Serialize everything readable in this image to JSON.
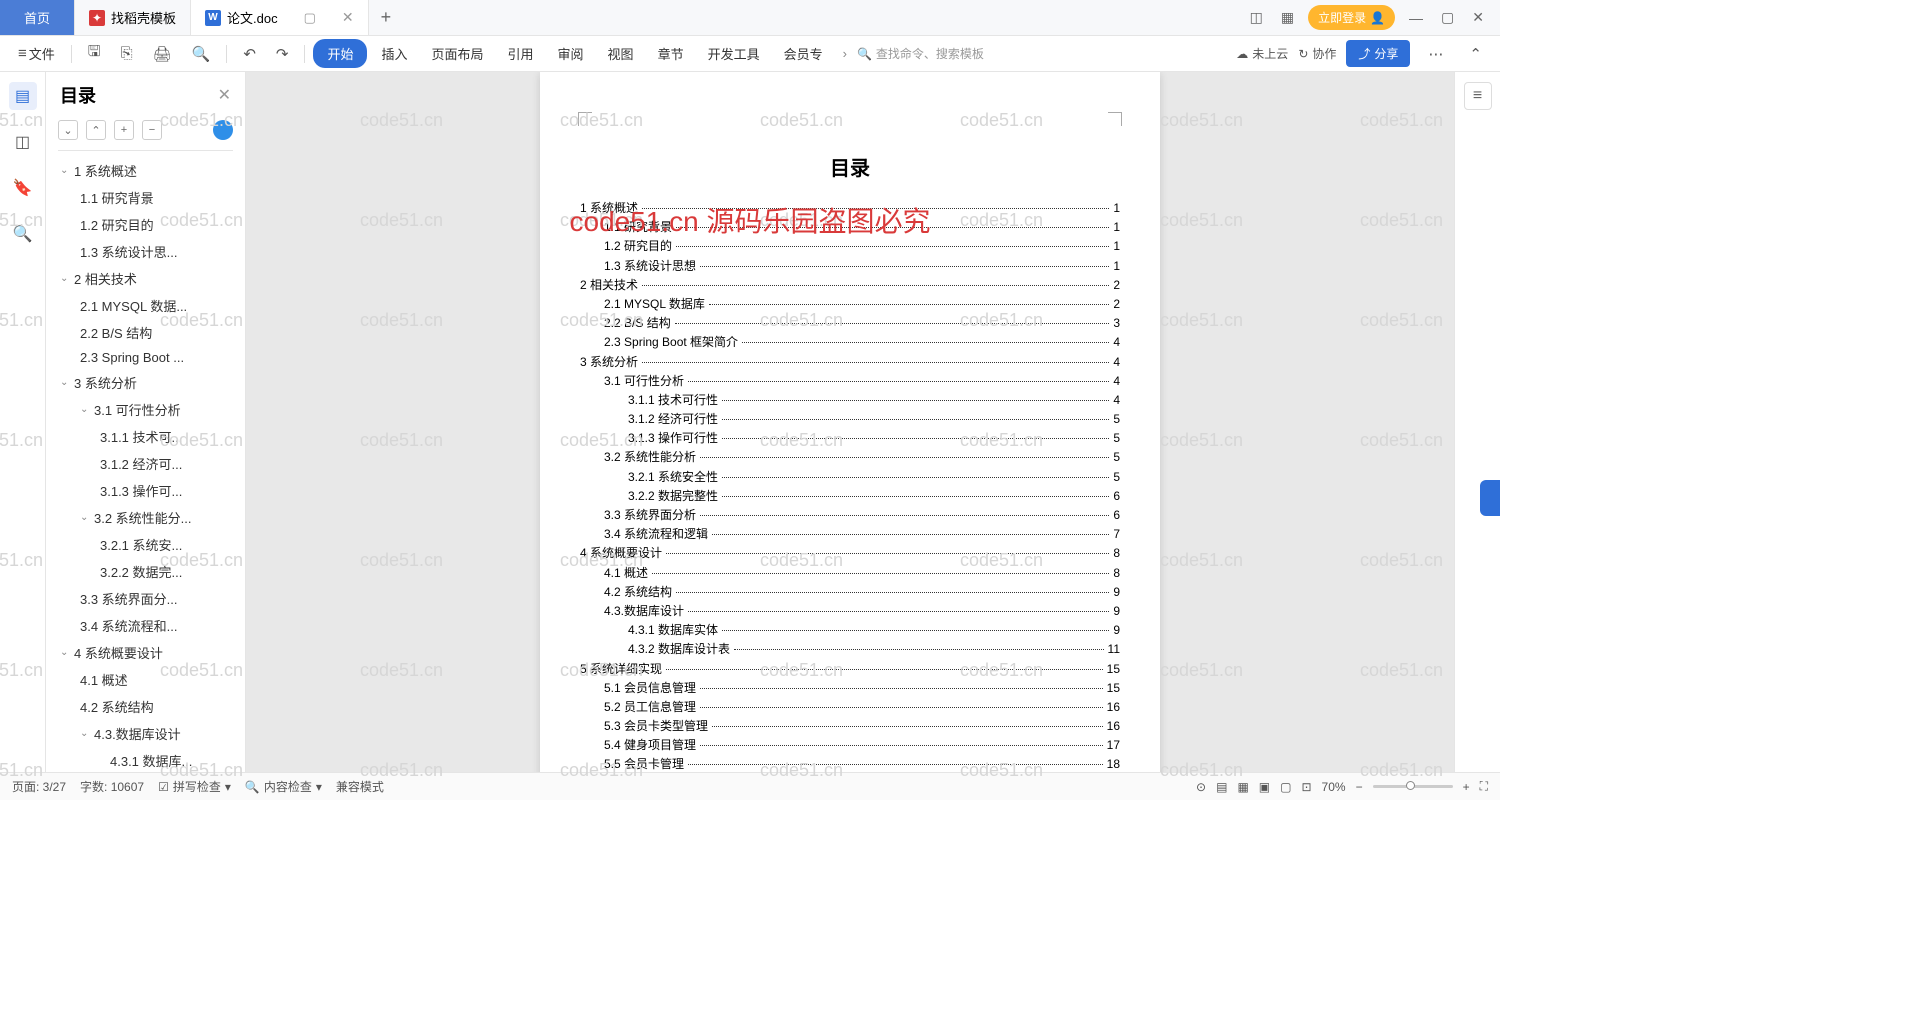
{
  "titlebar": {
    "home": "首页",
    "tab1": "找稻壳模板",
    "tab2": "论文.doc",
    "login": "立即登录"
  },
  "toolbar": {
    "file": "文件",
    "menus": [
      "开始",
      "插入",
      "页面布局",
      "引用",
      "审阅",
      "视图",
      "章节",
      "开发工具",
      "会员专"
    ],
    "search_cmd": "查找命令、搜索模板",
    "cloud": "未上云",
    "collab": "协作",
    "share": "分享"
  },
  "outline": {
    "title": "目录",
    "items": [
      {
        "lvl": 1,
        "chev": true,
        "t": "1 系统概述"
      },
      {
        "lvl": 2,
        "t": "1.1 研究背景"
      },
      {
        "lvl": 2,
        "t": "1.2 研究目的"
      },
      {
        "lvl": 2,
        "t": "1.3 系统设计思..."
      },
      {
        "lvl": 1,
        "chev": true,
        "t": "2 相关技术"
      },
      {
        "lvl": 2,
        "t": "2.1 MYSQL 数据..."
      },
      {
        "lvl": 2,
        "t": "2.2 B/S 结构"
      },
      {
        "lvl": 2,
        "t": "2.3 Spring Boot ..."
      },
      {
        "lvl": 1,
        "chev": true,
        "t": "3 系统分析"
      },
      {
        "lvl": 2,
        "chev": true,
        "t": "3.1 可行性分析"
      },
      {
        "lvl": 3,
        "t": "3.1.1 技术可..."
      },
      {
        "lvl": 3,
        "t": "3.1.2 经济可..."
      },
      {
        "lvl": 3,
        "t": "3.1.3 操作可..."
      },
      {
        "lvl": 2,
        "chev": true,
        "t": "3.2 系统性能分..."
      },
      {
        "lvl": 3,
        "t": "3.2.1  系统安..."
      },
      {
        "lvl": 3,
        "t": "3.2.2 数据完..."
      },
      {
        "lvl": 2,
        "t": "3.3 系统界面分..."
      },
      {
        "lvl": 2,
        "t": "3.4 系统流程和..."
      },
      {
        "lvl": 1,
        "chev": true,
        "t": "4 系统概要设计"
      },
      {
        "lvl": 2,
        "t": "4.1 概述"
      },
      {
        "lvl": 2,
        "t": "4.2 系统结构"
      },
      {
        "lvl": 2,
        "chev": true,
        "t": "4.3.数据库设计"
      },
      {
        "lvl": 4,
        "t": "4.3.1 数据库..."
      }
    ]
  },
  "doc": {
    "title": "目录",
    "toc": [
      {
        "l": 1,
        "t": "1 系统概述",
        "p": "1"
      },
      {
        "l": 2,
        "t": "1.1 研究背景",
        "p": "1"
      },
      {
        "l": 2,
        "t": "1.2 研究目的",
        "p": "1"
      },
      {
        "l": 2,
        "t": "1.3 系统设计思想",
        "p": "1"
      },
      {
        "l": 1,
        "t": "2 相关技术",
        "p": "2"
      },
      {
        "l": 2,
        "t": "2.1 MYSQL 数据库",
        "p": "2"
      },
      {
        "l": 2,
        "t": "2.2 B/S 结构",
        "p": "3"
      },
      {
        "l": 2,
        "t": "2.3 Spring Boot 框架简介",
        "p": "4"
      },
      {
        "l": 1,
        "t": "3 系统分析",
        "p": "4"
      },
      {
        "l": 2,
        "t": "3.1 可行性分析",
        "p": "4"
      },
      {
        "l": 3,
        "t": "3.1.1 技术可行性",
        "p": "4"
      },
      {
        "l": 3,
        "t": "3.1.2 经济可行性",
        "p": "5"
      },
      {
        "l": 3,
        "t": "3.1.3 操作可行性",
        "p": "5"
      },
      {
        "l": 2,
        "t": "3.2 系统性能分析",
        "p": "5"
      },
      {
        "l": 3,
        "t": "3.2.1  系统安全性",
        "p": "5"
      },
      {
        "l": 3,
        "t": "3.2.2 数据完整性",
        "p": "6"
      },
      {
        "l": 2,
        "t": "3.3 系统界面分析",
        "p": "6"
      },
      {
        "l": 2,
        "t": "3.4 系统流程和逻辑",
        "p": "7"
      },
      {
        "l": 1,
        "t": "4 系统概要设计",
        "p": "8"
      },
      {
        "l": 2,
        "t": "4.1 概述",
        "p": "8"
      },
      {
        "l": 2,
        "t": "4.2 系统结构",
        "p": "9"
      },
      {
        "l": 2,
        "t": "4.3.数据库设计",
        "p": "9"
      },
      {
        "l": 3,
        "t": "4.3.1 数据库实体",
        "p": "9"
      },
      {
        "l": 3,
        "t": "4.3.2 数据库设计表",
        "p": "11"
      },
      {
        "l": 1,
        "t": "5 系统详细实现",
        "p": "15"
      },
      {
        "l": 2,
        "t": "5.1 会员信息管理",
        "p": "15"
      },
      {
        "l": 2,
        "t": "5.2 员工信息管理",
        "p": "16"
      },
      {
        "l": 2,
        "t": "5.3 会员卡类型管理",
        "p": "16"
      },
      {
        "l": 2,
        "t": "5.4 健身项目管理",
        "p": "17"
      },
      {
        "l": 2,
        "t": "5.5 会员卡管理",
        "p": "18"
      }
    ]
  },
  "watermark_main": "code51.cn    源码乐园盗图必究",
  "watermark_bg": "code51.cn",
  "status": {
    "page": "页面: 3/27",
    "words": "字数: 10607",
    "spell": "拼写检查",
    "content": "内容检查",
    "compat": "兼容模式",
    "zoom": "70%"
  }
}
